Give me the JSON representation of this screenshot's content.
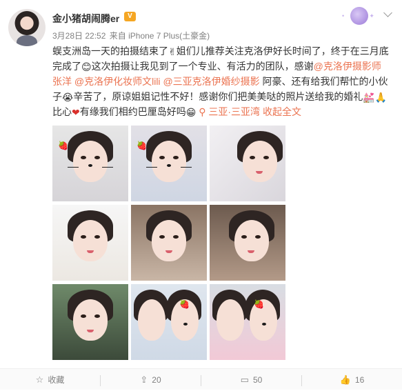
{
  "user": {
    "name": "金小猪胡闹腾er",
    "badge": "V"
  },
  "meta": {
    "date": "3月28日 22:52",
    "from": "来自",
    "device": "iPhone 7 Plus(土豪金)"
  },
  "post": {
    "seg1": "蜈支洲岛一天的拍摄结束了",
    "emoji1": "✌",
    "seg2": "姐们儿推荐关注克洛伊好长时间了，终于在三月底完成了",
    "emoji2": "😊",
    "seg3": "这次拍摄让我见到了一个专业、有活力的团队，感谢",
    "mention1": "@克洛伊摄影师张洋",
    "mention2": "@克洛伊化妆师文lili",
    "mention3": "@三亚克洛伊婚纱摄影",
    "seg4": "阿豪、还有给我们帮忙的小伙子",
    "emoji3": "😭",
    "seg5": "辛苦了，原谅姐姐记性不好！感谢你们把美美哒的照片送给我的婚礼",
    "emoji4": "💒",
    "emoji5": "🙏",
    "seg6": "比心",
    "emoji6": "❤",
    "seg7": "有缘我们相约巴厘岛好吗",
    "emoji7": "😁",
    "location": "三亚·三亚湾",
    "collapse": "收起全文"
  },
  "photos": [
    {
      "label": "photo-1"
    },
    {
      "label": "photo-2"
    },
    {
      "label": "photo-3"
    },
    {
      "label": "photo-4"
    },
    {
      "label": "photo-5"
    },
    {
      "label": "photo-6"
    },
    {
      "label": "photo-7"
    },
    {
      "label": "photo-8"
    },
    {
      "label": "photo-9"
    }
  ],
  "actions": {
    "favorite": "收藏",
    "repost": "20",
    "comment": "50",
    "like": "16"
  },
  "colors": {
    "link": "#eb7350",
    "badge": "#f5a623"
  }
}
